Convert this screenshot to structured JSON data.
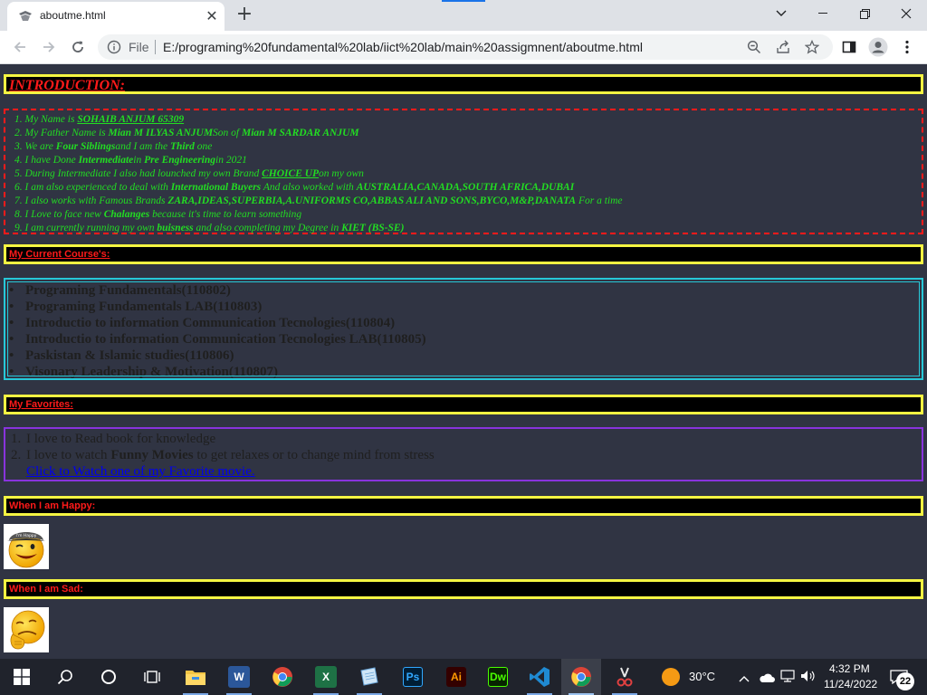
{
  "browser": {
    "tab_title": "aboutme.html",
    "new_tab_symbol": "+",
    "omnibox_scheme_label": "File",
    "url": "E:/programing%20fundamental%20lab/iict%20lab/main%20assigmnent/aboutme.html"
  },
  "page": {
    "intro_heading": "INTRODUCTION:",
    "intro_lines": [
      {
        "num": "1.",
        "pre": "My Name is ",
        "u": "SOHAIB ANJUM 65309",
        "rest": ""
      },
      {
        "num": "2.",
        "pre": "My Father Name is ",
        "b": "Mian M ILYAS ANJUM",
        "post": "Son of ",
        "b2": "Mian M SARDAR ANJUM"
      },
      {
        "num": "3.",
        "pre": "We are ",
        "b": "Four Siblings",
        "post": "and I am the ",
        "b2": "Third",
        "post2": " one"
      },
      {
        "num": "4.",
        "pre": "I have Done ",
        "b": "Intermediate",
        "post": "in ",
        "b2": "Pre Engineering",
        "post2": "in 2021"
      },
      {
        "num": "5.",
        "pre": "During Intermediate I also had lounched my own Brand ",
        "u": "CHOICE UP",
        "rest": "on my own"
      },
      {
        "num": "6.",
        "pre": "I am also experienced to deal with ",
        "b": "International Buyers",
        "post": " And also worked with ",
        "b2": "AUSTRALIA,CANADA,SOUTH AFRICA,DUBAI"
      },
      {
        "num": "7.",
        "pre": "I also works with Famous Brands ",
        "b": "ZARA,IDEAS,SUPERBIA,A.UNIFORMS CO,ABBAS ALI AND SONS,BYCO,M&P,DANATA",
        "post": " For a time"
      },
      {
        "num": "8.",
        "pre": "I Love to face new ",
        "b": "Chalanges",
        "post": " because it's time to learn something"
      },
      {
        "num": "9.",
        "pre": "I am currently running my own ",
        "b": "buisness",
        "post": " and also completing my Degree in ",
        "b2": "KIET (BS-SE)"
      }
    ],
    "courses_heading": "My Current Course's:",
    "bullet": "•",
    "courses": [
      "Programing Fundamentals(110802)",
      "Programing Fundamentals LAB(110803)",
      "Introductio to information Communication Tecnologies(110804)",
      "Introductio to information Communication Tecnologies LAB(110805)",
      "Paskistan & Islamic studies(110806)",
      "Visonary Leadership & Motivation(110807)"
    ],
    "favorites_heading": "My Favorites:",
    "favorites": {
      "item1_num": "1.",
      "item1": "I love to Read book for knowledge",
      "item2_num": "2.",
      "item2_pre": "I love to watch ",
      "item2_bold": "Funny Movies",
      "item2_post": " to get relaxes or to change mind from stress",
      "link": "Click to Watch one of my Favorite movie."
    },
    "happy_heading": "When I am Happy:",
    "sad_heading": "When I am Sad:",
    "happy_cap_text": "I'm Happy"
  },
  "taskbar": {
    "weather": "30°C",
    "time": "4:32 PM",
    "date": "11/24/2022",
    "notifications": "22",
    "apps": [
      "windows-start",
      "search",
      "cortana",
      "task-view",
      "file-explorer",
      "word",
      "chrome",
      "excel",
      "notepad",
      "photoshop",
      "illustrator",
      "dreamweaver",
      "vscode",
      "chrome-active",
      "snipping-tool"
    ],
    "app_letters": {
      "word": "W",
      "excel": "X",
      "photoshop": "Ps",
      "illustrator": "Ai",
      "dreamweaver": "Dw"
    },
    "colors": {
      "word": "#2b579a",
      "excel": "#1e7145",
      "photoshop": "#001e36",
      "illustrator": "#330000",
      "dreamweaver": "#072401"
    }
  },
  "colors": {
    "page_bg": "#303443",
    "heading_border": "#f5f542",
    "heading_text": "#ff1a1a",
    "intro_text": "#22dd22",
    "intro_border": "#ff1a1a",
    "courses_border": "#27c8d8",
    "favorites_border": "#8833dd",
    "link": "#0000ee"
  }
}
